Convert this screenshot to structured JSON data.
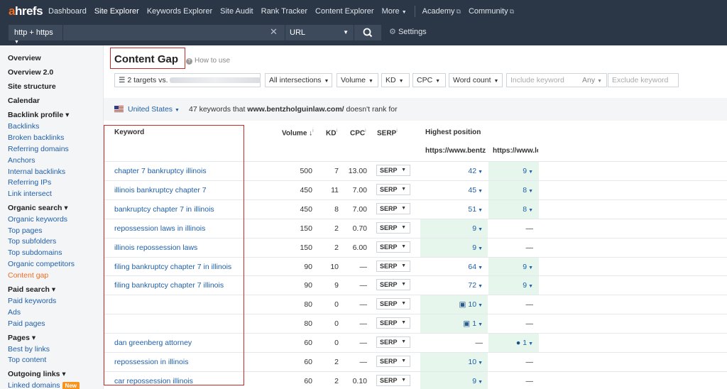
{
  "nav": {
    "logo_a": "a",
    "logo_rest": "hrefs",
    "items": [
      "Dashboard",
      "Site Explorer",
      "Keywords Explorer",
      "Site Audit",
      "Rank Tracker",
      "Content Explorer",
      "More"
    ],
    "academy": "Academy",
    "community": "Community"
  },
  "search": {
    "protocol": "http + https",
    "mode": "URL",
    "settings": "Settings"
  },
  "sidebar": [
    {
      "label": "Overview",
      "kind": "head"
    },
    {
      "label": "Overview 2.0",
      "kind": "head"
    },
    {
      "label": "Site structure",
      "kind": "head"
    },
    {
      "label": "Calendar",
      "kind": "head"
    },
    {
      "label": "Backlink profile ▾",
      "kind": "head"
    },
    {
      "label": "Backlinks",
      "kind": "link"
    },
    {
      "label": "Broken backlinks",
      "kind": "link"
    },
    {
      "label": "Referring domains",
      "kind": "link"
    },
    {
      "label": "Anchors",
      "kind": "link"
    },
    {
      "label": "Internal backlinks",
      "kind": "link"
    },
    {
      "label": "Referring IPs",
      "kind": "link"
    },
    {
      "label": "Link intersect",
      "kind": "link"
    },
    {
      "label": "Organic search ▾",
      "kind": "head"
    },
    {
      "label": "Organic keywords",
      "kind": "link"
    },
    {
      "label": "Top pages",
      "kind": "link"
    },
    {
      "label": "Top subfolders",
      "kind": "link"
    },
    {
      "label": "Top subdomains",
      "kind": "link"
    },
    {
      "label": "Organic competitors",
      "kind": "link"
    },
    {
      "label": "Content gap",
      "kind": "current"
    },
    {
      "label": "Paid search ▾",
      "kind": "head"
    },
    {
      "label": "Paid keywords",
      "kind": "link"
    },
    {
      "label": "Ads",
      "kind": "link"
    },
    {
      "label": "Paid pages",
      "kind": "link"
    },
    {
      "label": "Pages ▾",
      "kind": "head"
    },
    {
      "label": "Best by links",
      "kind": "link"
    },
    {
      "label": "Top content",
      "kind": "link"
    },
    {
      "label": "Outgoing links ▾",
      "kind": "head"
    },
    {
      "label": "Linked domains",
      "kind": "link",
      "badge": "New"
    }
  ],
  "page": {
    "title": "Content Gap",
    "how_to": "How to use"
  },
  "filters": {
    "targets": "2 targets vs.",
    "intersections": "All intersections",
    "volume": "Volume",
    "kd": "KD",
    "cpc": "CPC",
    "word_count": "Word count",
    "include_placeholder": "Include keyword",
    "any": "Any",
    "exclude_placeholder": "Exclude keyword"
  },
  "info": {
    "country": "United States",
    "prefix": "47 keywords that ",
    "domain": "www.bentzholguinlaw.com/",
    "suffix": " doesn't rank for"
  },
  "table": {
    "headers": {
      "keyword": "Keyword",
      "volume": "Volume",
      "kd": "KD",
      "cpc": "CPC",
      "serp": "SERP",
      "highest": "Highest position"
    },
    "col1": "https://www.bentzh",
    "col2": "https://www.lo",
    "serp_label": "SERP",
    "rows": [
      {
        "keyword": "chapter 7 bankruptcy illinois",
        "volume": "500",
        "kd": "7",
        "cpc": "13.00",
        "p1": "42",
        "p1_green": false,
        "p1_icon": "",
        "p2": "9",
        "p2_green": true,
        "p2_icon": ""
      },
      {
        "keyword": "illinois bankruptcy chapter 7",
        "volume": "450",
        "kd": "11",
        "cpc": "7.00",
        "p1": "45",
        "p1_green": false,
        "p1_icon": "",
        "p2": "8",
        "p2_green": true,
        "p2_icon": ""
      },
      {
        "keyword": "bankruptcy chapter 7 in illinois",
        "volume": "450",
        "kd": "8",
        "cpc": "7.00",
        "p1": "51",
        "p1_green": false,
        "p1_icon": "",
        "p2": "8",
        "p2_green": true,
        "p2_icon": ""
      },
      {
        "keyword": "repossession laws in illinois",
        "volume": "150",
        "kd": "2",
        "cpc": "0.70",
        "p1": "9",
        "p1_green": true,
        "p1_icon": "",
        "p2": "—",
        "p2_green": false,
        "p2_icon": ""
      },
      {
        "keyword": "illinois repossession laws",
        "volume": "150",
        "kd": "2",
        "cpc": "6.00",
        "p1": "9",
        "p1_green": true,
        "p1_icon": "",
        "p2": "—",
        "p2_green": false,
        "p2_icon": ""
      },
      {
        "keyword": "filing bankruptcy chapter 7 in illinois",
        "volume": "90",
        "kd": "10",
        "cpc": "—",
        "p1": "64",
        "p1_green": false,
        "p1_icon": "",
        "p2": "9",
        "p2_green": true,
        "p2_icon": ""
      },
      {
        "keyword": "filing bankruptcy chapter 7 illinois",
        "volume": "90",
        "kd": "9",
        "cpc": "—",
        "p1": "72",
        "p1_green": false,
        "p1_icon": "",
        "p2": "9",
        "p2_green": true,
        "p2_icon": ""
      },
      {
        "keyword": "",
        "volume": "80",
        "kd": "0",
        "cpc": "—",
        "p1": "10",
        "p1_green": true,
        "p1_icon": "image",
        "p2": "—",
        "p2_green": false,
        "p2_icon": ""
      },
      {
        "keyword": "",
        "volume": "80",
        "kd": "0",
        "cpc": "—",
        "p1": "1",
        "p1_green": true,
        "p1_icon": "image",
        "p2": "—",
        "p2_green": false,
        "p2_icon": ""
      },
      {
        "keyword": "dan greenberg attorney",
        "volume": "60",
        "kd": "0",
        "cpc": "—",
        "p1": "—",
        "p1_green": false,
        "p1_icon": "",
        "p2": "1",
        "p2_green": true,
        "p2_icon": "pin"
      },
      {
        "keyword": "repossession in illinois",
        "volume": "60",
        "kd": "2",
        "cpc": "—",
        "p1": "10",
        "p1_green": true,
        "p1_icon": "",
        "p2": "—",
        "p2_green": false,
        "p2_icon": ""
      },
      {
        "keyword": "car repossession illinois",
        "volume": "60",
        "kd": "2",
        "cpc": "0.10",
        "p1": "9",
        "p1_green": true,
        "p1_icon": "",
        "p2": "—",
        "p2_green": false,
        "p2_icon": ""
      }
    ]
  }
}
